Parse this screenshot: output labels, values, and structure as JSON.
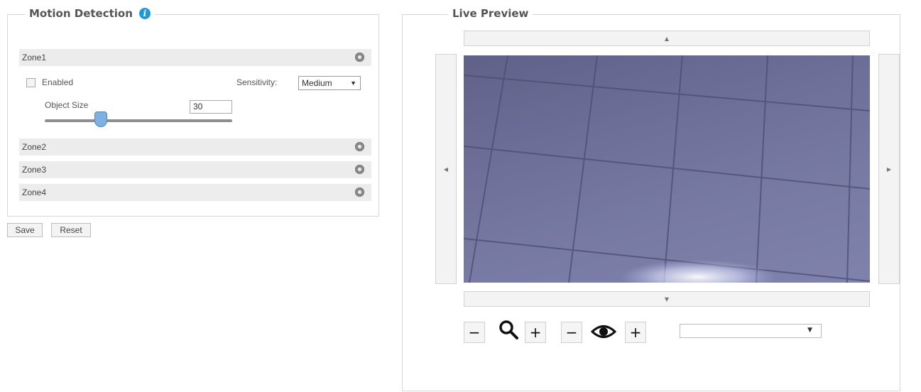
{
  "motion_detection": {
    "title": "Motion Detection",
    "info_icon": "i",
    "zones": [
      {
        "label": "Zone1"
      },
      {
        "label": "Zone2"
      },
      {
        "label": "Zone3"
      },
      {
        "label": "Zone4"
      }
    ],
    "zone1": {
      "enabled_label": "Enabled",
      "enabled_checked": false,
      "sensitivity_label": "Sensitivity:",
      "sensitivity_value": "Medium",
      "object_size_label": "Object Size",
      "object_size_value": "30",
      "object_size_slider_fraction": 0.3
    }
  },
  "buttons": {
    "save": "Save",
    "reset": "Reset"
  },
  "live_preview": {
    "title": "Live Preview",
    "pan_up": "▲",
    "pan_down": "▼",
    "pan_left": "◀",
    "pan_right": "▶",
    "zoom_minus": "−",
    "zoom_plus": "+",
    "focus_minus": "−",
    "focus_plus": "+",
    "zoom_icon": "magnifier-icon",
    "focus_icon": "eye-icon",
    "stream_select_value": ""
  },
  "colors": {
    "info_blue": "#1e9ad6",
    "slider_handle": "#7fb0e2",
    "preview_tint": "#6d6f98"
  }
}
